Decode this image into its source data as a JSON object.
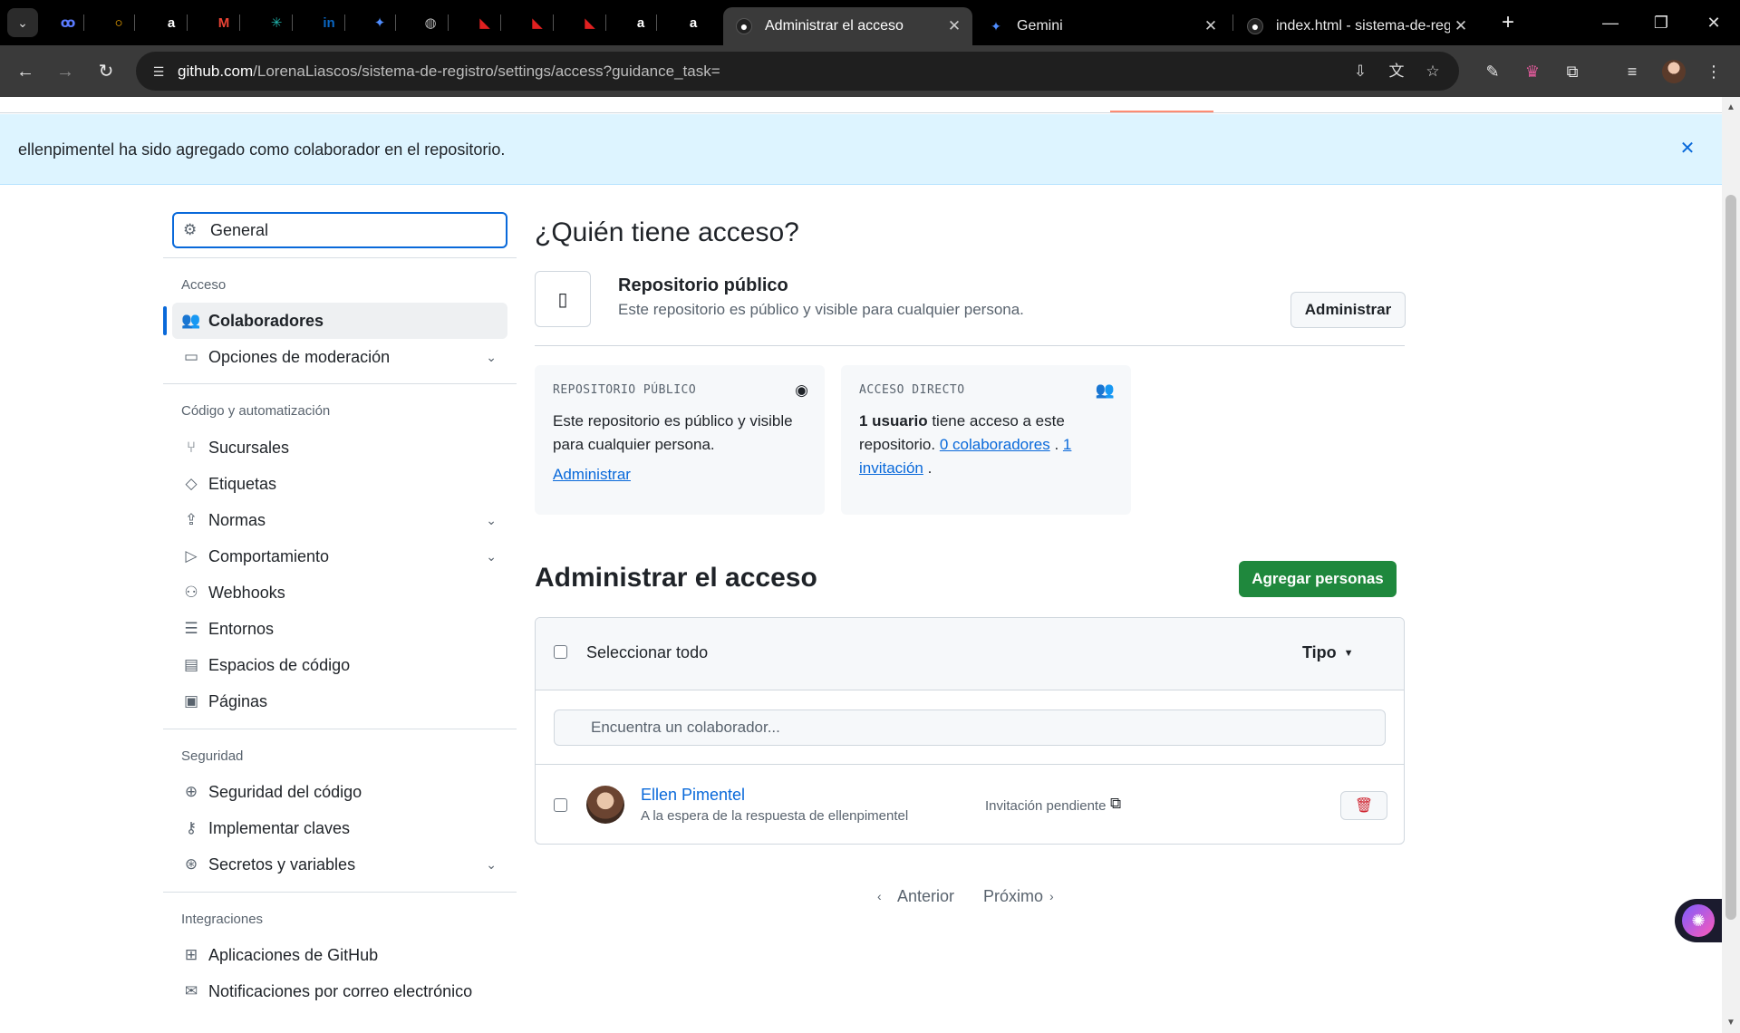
{
  "browser": {
    "pinned_tabs": [
      {
        "icon": "polymer-icon",
        "glyph": "ꝏ",
        "color": "#5a7bff"
      },
      {
        "icon": "ring-icon",
        "glyph": "○",
        "color": "#ffb000"
      },
      {
        "icon": "alura-icon",
        "glyph": "a",
        "color": "#ffffff"
      },
      {
        "icon": "gmail-icon",
        "glyph": "M",
        "color": "#ea4335"
      },
      {
        "icon": "perplexity-icon",
        "glyph": "✳",
        "color": "#20b2aa"
      },
      {
        "icon": "linkedin-icon",
        "glyph": "in",
        "color": "#0a66c2"
      },
      {
        "icon": "gemini-icon",
        "glyph": "✦",
        "color": "#4f8dff"
      },
      {
        "icon": "globe-icon",
        "glyph": "◍",
        "color": "#bbbbbb"
      },
      {
        "icon": "fiveminute-icon",
        "glyph": "◣",
        "color": "#e02020"
      },
      {
        "icon": "fiveminute-icon",
        "glyph": "◣",
        "color": "#e02020"
      },
      {
        "icon": "fiveminute-icon",
        "glyph": "◣",
        "color": "#e02020"
      },
      {
        "icon": "alura-icon",
        "glyph": "a",
        "color": "#ffffff"
      },
      {
        "icon": "alura-icon",
        "glyph": "a",
        "color": "#ffffff"
      }
    ],
    "tabs": [
      {
        "title": "Administrar el acceso",
        "icon": "github-icon",
        "active": true
      },
      {
        "title": "Gemini",
        "icon": "gemini-icon",
        "active": false
      },
      {
        "title": "index.html - sistema-de-regis",
        "icon": "github-icon",
        "active": false
      }
    ],
    "url_host": "github.com",
    "url_path": "/LorenaLiascos/sistema-de-registro/settings/access?guidance_task="
  },
  "flash": {
    "message": "ellenpimentel ha sido agregado como colaborador en el repositorio."
  },
  "sidebar": {
    "general": "General",
    "sections": {
      "access": "Acceso",
      "code": "Código y automatización",
      "security": "Seguridad",
      "integrations": "Integraciones"
    },
    "items": {
      "collaborators": "Colaboradores",
      "moderation": "Opciones de moderación",
      "branches": "Sucursales",
      "tags": "Etiquetas",
      "rules": "Normas",
      "behavior": "Comportamiento",
      "webhooks": "Webhooks",
      "environments": "Entornos",
      "codespaces": "Espacios de código",
      "pages": "Páginas",
      "code_security": "Seguridad del código",
      "deploy_keys": "Implementar claves",
      "secrets": "Secretos y variables",
      "github_apps": "Aplicaciones de GitHub",
      "email_notifications": "Notificaciones por correo electrónico"
    }
  },
  "main": {
    "who_heading": "¿Quién tiene acceso?",
    "repo_title": "Repositorio público",
    "repo_desc": "Este repositorio es público y visible para cualquier persona.",
    "manage_button": "Administrar",
    "card_public": {
      "title": "REPOSITORIO PÚBLICO",
      "body": "Este repositorio es público y visible para cualquier persona.",
      "link": "Administrar"
    },
    "card_direct": {
      "title": "ACCESO DIRECTO",
      "users_bold": "1 usuario",
      "body_after": " tiene acceso a este repositorio. ",
      "collaborators_link": "0 colaboradores",
      "separator": " . ",
      "invitation_link": "1 invitación",
      "end": " ."
    },
    "manage_heading": "Administrar el acceso",
    "add_people": "Agregar personas",
    "select_all": "Seleccionar todo",
    "type_filter": "Tipo",
    "search_placeholder": "Encuentra un colaborador...",
    "collaborator": {
      "name": "Ellen Pimentel",
      "subtitle": "A la espera de la respuesta de ellenpimentel",
      "status": "Invitación pendiente"
    },
    "pagination": {
      "previous": "Anterior",
      "next": "Próximo"
    }
  },
  "colors": {
    "accent": "#0969da",
    "primary_button": "#1f883d",
    "flash_bg": "#ddf4ff",
    "danger": "#cf222e"
  }
}
